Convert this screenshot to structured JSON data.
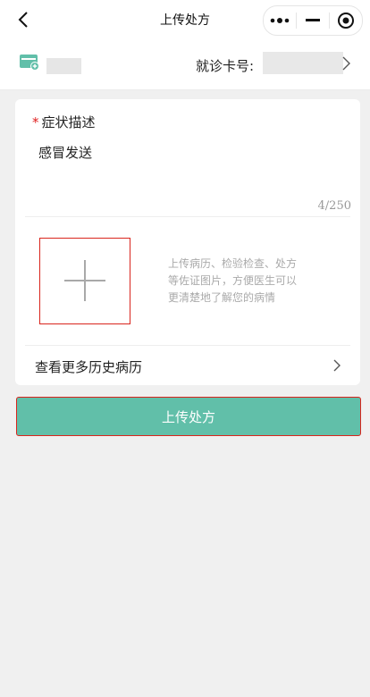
{
  "navbar": {
    "title": "上传处方",
    "back_icon": "chevron-left-icon",
    "more_icon": "more-dots-icon",
    "minimize_icon": "minimize-icon",
    "close_icon": "target-close-icon"
  },
  "card": {
    "icon": "card-plus-icon",
    "label": "就诊卡号:",
    "accent": "#61bfa9"
  },
  "symptom": {
    "required_mark": "*",
    "title": "症状描述",
    "value": "感冒发送",
    "counter": "4/250"
  },
  "upload": {
    "icon": "plus-icon",
    "hint_lines": [
      "上传病历、检验检查、处方",
      "等佐证图片，方便医生可以",
      "更清楚地了解您的病情"
    ]
  },
  "history": {
    "label": "查看更多历史病历"
  },
  "submit": {
    "label": "上传处方",
    "color": "#61bfa9"
  }
}
